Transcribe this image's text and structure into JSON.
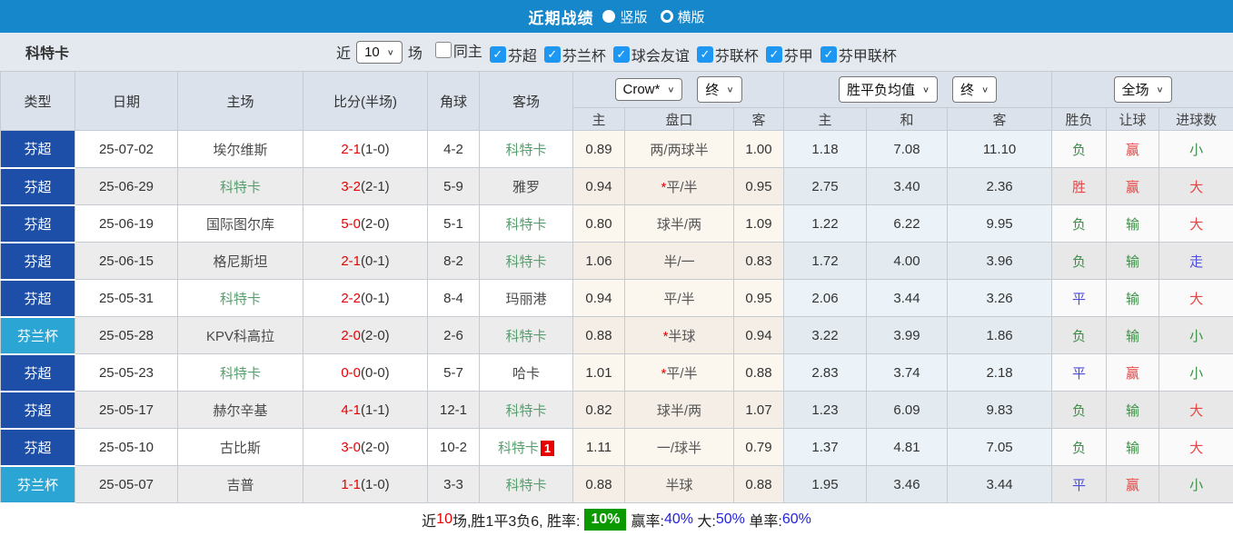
{
  "topbar": {
    "title": "近期战绩",
    "radio_vertical": "竖版",
    "radio_horizontal": "横版"
  },
  "filter": {
    "team": "科特卡",
    "near_label": "近",
    "rounds_value": "10",
    "rounds_suffix": "场",
    "checkboxes": [
      {
        "label": "同主",
        "checked": false
      },
      {
        "label": "芬超",
        "checked": true
      },
      {
        "label": "芬兰杯",
        "checked": true
      },
      {
        "label": "球会友谊",
        "checked": true
      },
      {
        "label": "芬联杯",
        "checked": true
      },
      {
        "label": "芬甲",
        "checked": true
      },
      {
        "label": "芬甲联杯",
        "checked": true
      }
    ]
  },
  "table": {
    "left_headers": [
      "类型",
      "日期",
      "主场",
      "比分(半场)",
      "角球",
      "客场"
    ],
    "odds_subheaders": [
      "主",
      "盘口",
      "客"
    ],
    "wdl_subheaders": [
      "主",
      "和",
      "客"
    ],
    "result_subheaders": [
      "胜负",
      "让球",
      "进球数"
    ],
    "selects": {
      "odds_company": "Crow*",
      "odds_state": "终",
      "wdl_avg": "胜平负均值",
      "wdl_state": "终",
      "scope": "全场"
    },
    "type_colors": {
      "芬超": "#1d4fa8",
      "芬兰杯": "#2ba6d4"
    },
    "text_colors": {
      "green": "#3d8f47",
      "red": "#e84444",
      "blue": "#4c4ce0",
      "score_red": "#e60000",
      "team_green": "#57a06e",
      "team_plain": "#4a4a4a"
    },
    "rows": [
      {
        "type": "芬超",
        "date": "25-07-02",
        "home": "埃尔维斯",
        "home_focus": false,
        "score": "2-1",
        "half": "(1-0)",
        "corner": "4-2",
        "away": "科特卡",
        "away_focus": true,
        "away_badge": "",
        "odds_home": "0.89",
        "handicap": "两/两球半",
        "handicap_star": false,
        "odds_away": "1.00",
        "avg_win": "1.18",
        "avg_draw": "7.08",
        "avg_lose": "11.10",
        "res_wdl": "负",
        "res_wdl_color": "green",
        "res_hcap": "赢",
        "res_hcap_color": "red",
        "res_goal": "小",
        "res_goal_color": "green"
      },
      {
        "type": "芬超",
        "date": "25-06-29",
        "home": "科特卡",
        "home_focus": true,
        "score": "3-2",
        "half": "(2-1)",
        "corner": "5-9",
        "away": "雅罗",
        "away_focus": false,
        "away_badge": "",
        "odds_home": "0.94",
        "handicap": "平/半",
        "handicap_star": true,
        "odds_away": "0.95",
        "avg_win": "2.75",
        "avg_draw": "3.40",
        "avg_lose": "2.36",
        "res_wdl": "胜",
        "res_wdl_color": "red",
        "res_hcap": "赢",
        "res_hcap_color": "red",
        "res_goal": "大",
        "res_goal_color": "red"
      },
      {
        "type": "芬超",
        "date": "25-06-19",
        "home": "国际图尔库",
        "home_focus": false,
        "score": "5-0",
        "half": "(2-0)",
        "corner": "5-1",
        "away": "科特卡",
        "away_focus": true,
        "away_badge": "",
        "odds_home": "0.80",
        "handicap": "球半/两",
        "handicap_star": false,
        "odds_away": "1.09",
        "avg_win": "1.22",
        "avg_draw": "6.22",
        "avg_lose": "9.95",
        "res_wdl": "负",
        "res_wdl_color": "green",
        "res_hcap": "输",
        "res_hcap_color": "green",
        "res_goal": "大",
        "res_goal_color": "red"
      },
      {
        "type": "芬超",
        "date": "25-06-15",
        "home": "格尼斯坦",
        "home_focus": false,
        "score": "2-1",
        "half": "(0-1)",
        "corner": "8-2",
        "away": "科特卡",
        "away_focus": true,
        "away_badge": "",
        "odds_home": "1.06",
        "handicap": "半/一",
        "handicap_star": false,
        "odds_away": "0.83",
        "avg_win": "1.72",
        "avg_draw": "4.00",
        "avg_lose": "3.96",
        "res_wdl": "负",
        "res_wdl_color": "green",
        "res_hcap": "输",
        "res_hcap_color": "green",
        "res_goal": "走",
        "res_goal_color": "blue"
      },
      {
        "type": "芬超",
        "date": "25-05-31",
        "home": "科特卡",
        "home_focus": true,
        "score": "2-2",
        "half": "(0-1)",
        "corner": "8-4",
        "away": "玛丽港",
        "away_focus": false,
        "away_badge": "",
        "odds_home": "0.94",
        "handicap": "平/半",
        "handicap_star": false,
        "odds_away": "0.95",
        "avg_win": "2.06",
        "avg_draw": "3.44",
        "avg_lose": "3.26",
        "res_wdl": "平",
        "res_wdl_color": "blue",
        "res_hcap": "输",
        "res_hcap_color": "green",
        "res_goal": "大",
        "res_goal_color": "red"
      },
      {
        "type": "芬兰杯",
        "date": "25-05-28",
        "home": "KPV科高拉",
        "home_focus": false,
        "score": "2-0",
        "half": "(2-0)",
        "corner": "2-6",
        "away": "科特卡",
        "away_focus": true,
        "away_badge": "",
        "odds_home": "0.88",
        "handicap": "半球",
        "handicap_star": true,
        "odds_away": "0.94",
        "avg_win": "3.22",
        "avg_draw": "3.99",
        "avg_lose": "1.86",
        "res_wdl": "负",
        "res_wdl_color": "green",
        "res_hcap": "输",
        "res_hcap_color": "green",
        "res_goal": "小",
        "res_goal_color": "green"
      },
      {
        "type": "芬超",
        "date": "25-05-23",
        "home": "科特卡",
        "home_focus": true,
        "score": "0-0",
        "half": "(0-0)",
        "corner": "5-7",
        "away": "哈卡",
        "away_focus": false,
        "away_badge": "",
        "odds_home": "1.01",
        "handicap": "平/半",
        "handicap_star": true,
        "odds_away": "0.88",
        "avg_win": "2.83",
        "avg_draw": "3.74",
        "avg_lose": "2.18",
        "res_wdl": "平",
        "res_wdl_color": "blue",
        "res_hcap": "赢",
        "res_hcap_color": "red",
        "res_goal": "小",
        "res_goal_color": "green"
      },
      {
        "type": "芬超",
        "date": "25-05-17",
        "home": "赫尔辛基",
        "home_focus": false,
        "score": "4-1",
        "half": "(1-1)",
        "corner": "12-1",
        "away": "科特卡",
        "away_focus": true,
        "away_badge": "",
        "odds_home": "0.82",
        "handicap": "球半/两",
        "handicap_star": false,
        "odds_away": "1.07",
        "avg_win": "1.23",
        "avg_draw": "6.09",
        "avg_lose": "9.83",
        "res_wdl": "负",
        "res_wdl_color": "green",
        "res_hcap": "输",
        "res_hcap_color": "green",
        "res_goal": "大",
        "res_goal_color": "red"
      },
      {
        "type": "芬超",
        "date": "25-05-10",
        "home": "古比斯",
        "home_focus": false,
        "score": "3-0",
        "half": "(2-0)",
        "corner": "10-2",
        "away": "科特卡",
        "away_focus": true,
        "away_badge": "1",
        "odds_home": "1.11",
        "handicap": "一/球半",
        "handicap_star": false,
        "odds_away": "0.79",
        "avg_win": "1.37",
        "avg_draw": "4.81",
        "avg_lose": "7.05",
        "res_wdl": "负",
        "res_wdl_color": "green",
        "res_hcap": "输",
        "res_hcap_color": "green",
        "res_goal": "大",
        "res_goal_color": "red"
      },
      {
        "type": "芬兰杯",
        "date": "25-05-07",
        "home": "吉普",
        "home_focus": false,
        "score": "1-1",
        "half": "(1-0)",
        "corner": "3-3",
        "away": "科特卡",
        "away_focus": true,
        "away_badge": "",
        "odds_home": "0.88",
        "handicap": "半球",
        "handicap_star": false,
        "odds_away": "0.88",
        "avg_win": "1.95",
        "avg_draw": "3.46",
        "avg_lose": "3.44",
        "res_wdl": "平",
        "res_wdl_color": "blue",
        "res_hcap": "赢",
        "res_hcap_color": "red",
        "res_goal": "小",
        "res_goal_color": "green"
      }
    ]
  },
  "footer": {
    "box_bg": "#0a9a00",
    "segments": [
      {
        "text": "近",
        "color": "#222"
      },
      {
        "text": "10",
        "color": "#e60000"
      },
      {
        "text": "场,胜1平3负6, 胜率:",
        "color": "#222"
      },
      {
        "text": "10%",
        "color": "#fff",
        "box": true
      },
      {
        "text": "赢率:",
        "color": "#222"
      },
      {
        "text": "40%",
        "color": "#2222e0"
      },
      {
        "text": " 大:",
        "color": "#222"
      },
      {
        "text": "50%",
        "color": "#2222e0"
      },
      {
        "text": " 单率:",
        "color": "#222"
      },
      {
        "text": "60%",
        "color": "#2222e0"
      }
    ]
  }
}
